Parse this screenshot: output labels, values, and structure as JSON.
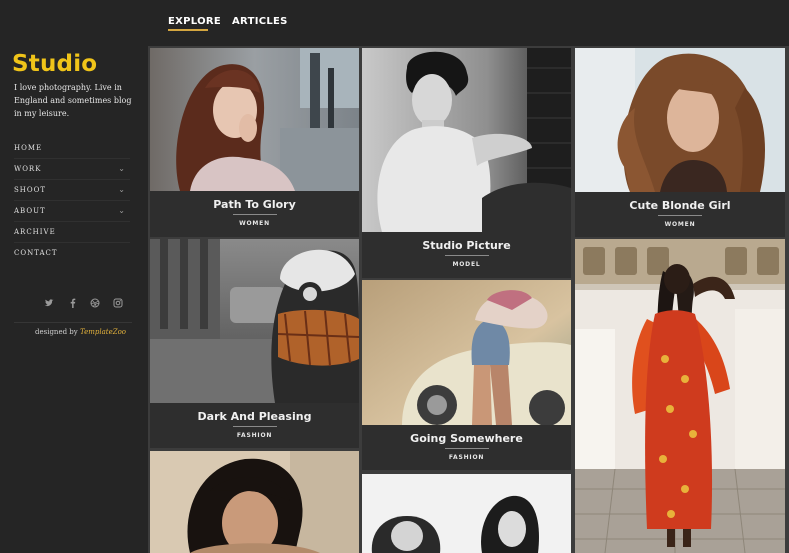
{
  "nav": {
    "tabs": [
      {
        "label": "EXPLORE",
        "active": true
      },
      {
        "label": "ARTICLES",
        "active": false
      }
    ],
    "accent_color": "#d4a640"
  },
  "sidebar": {
    "logo": "Studio",
    "logo_color": "#f0c419",
    "tagline": "I love photography. Live in England and sometimes blog in my leisure.",
    "menu": [
      {
        "label": "HOME",
        "has_submenu": false
      },
      {
        "label": "WORK",
        "has_submenu": true
      },
      {
        "label": "SHOOT",
        "has_submenu": true
      },
      {
        "label": "ABOUT",
        "has_submenu": true
      },
      {
        "label": "ARCHIVE",
        "has_submenu": false
      },
      {
        "label": "CONTACT",
        "has_submenu": false
      }
    ],
    "social_icons": [
      "twitter-icon",
      "facebook-icon",
      "dribbble-icon",
      "instagram-icon"
    ],
    "credit_prefix": "designed by",
    "credit_name": "TemplateZoo"
  },
  "gallery": {
    "items": [
      {
        "title": "Path To Glory",
        "category": "WOMEN"
      },
      {
        "title": "Studio Picture",
        "category": "MODEL"
      },
      {
        "title": "Cute Blonde Girl",
        "category": "WOMEN"
      },
      {
        "title": "Dark And Pleasing",
        "category": "FASHION"
      },
      {
        "title": "Going Somewhere",
        "category": "FASHION"
      }
    ]
  }
}
